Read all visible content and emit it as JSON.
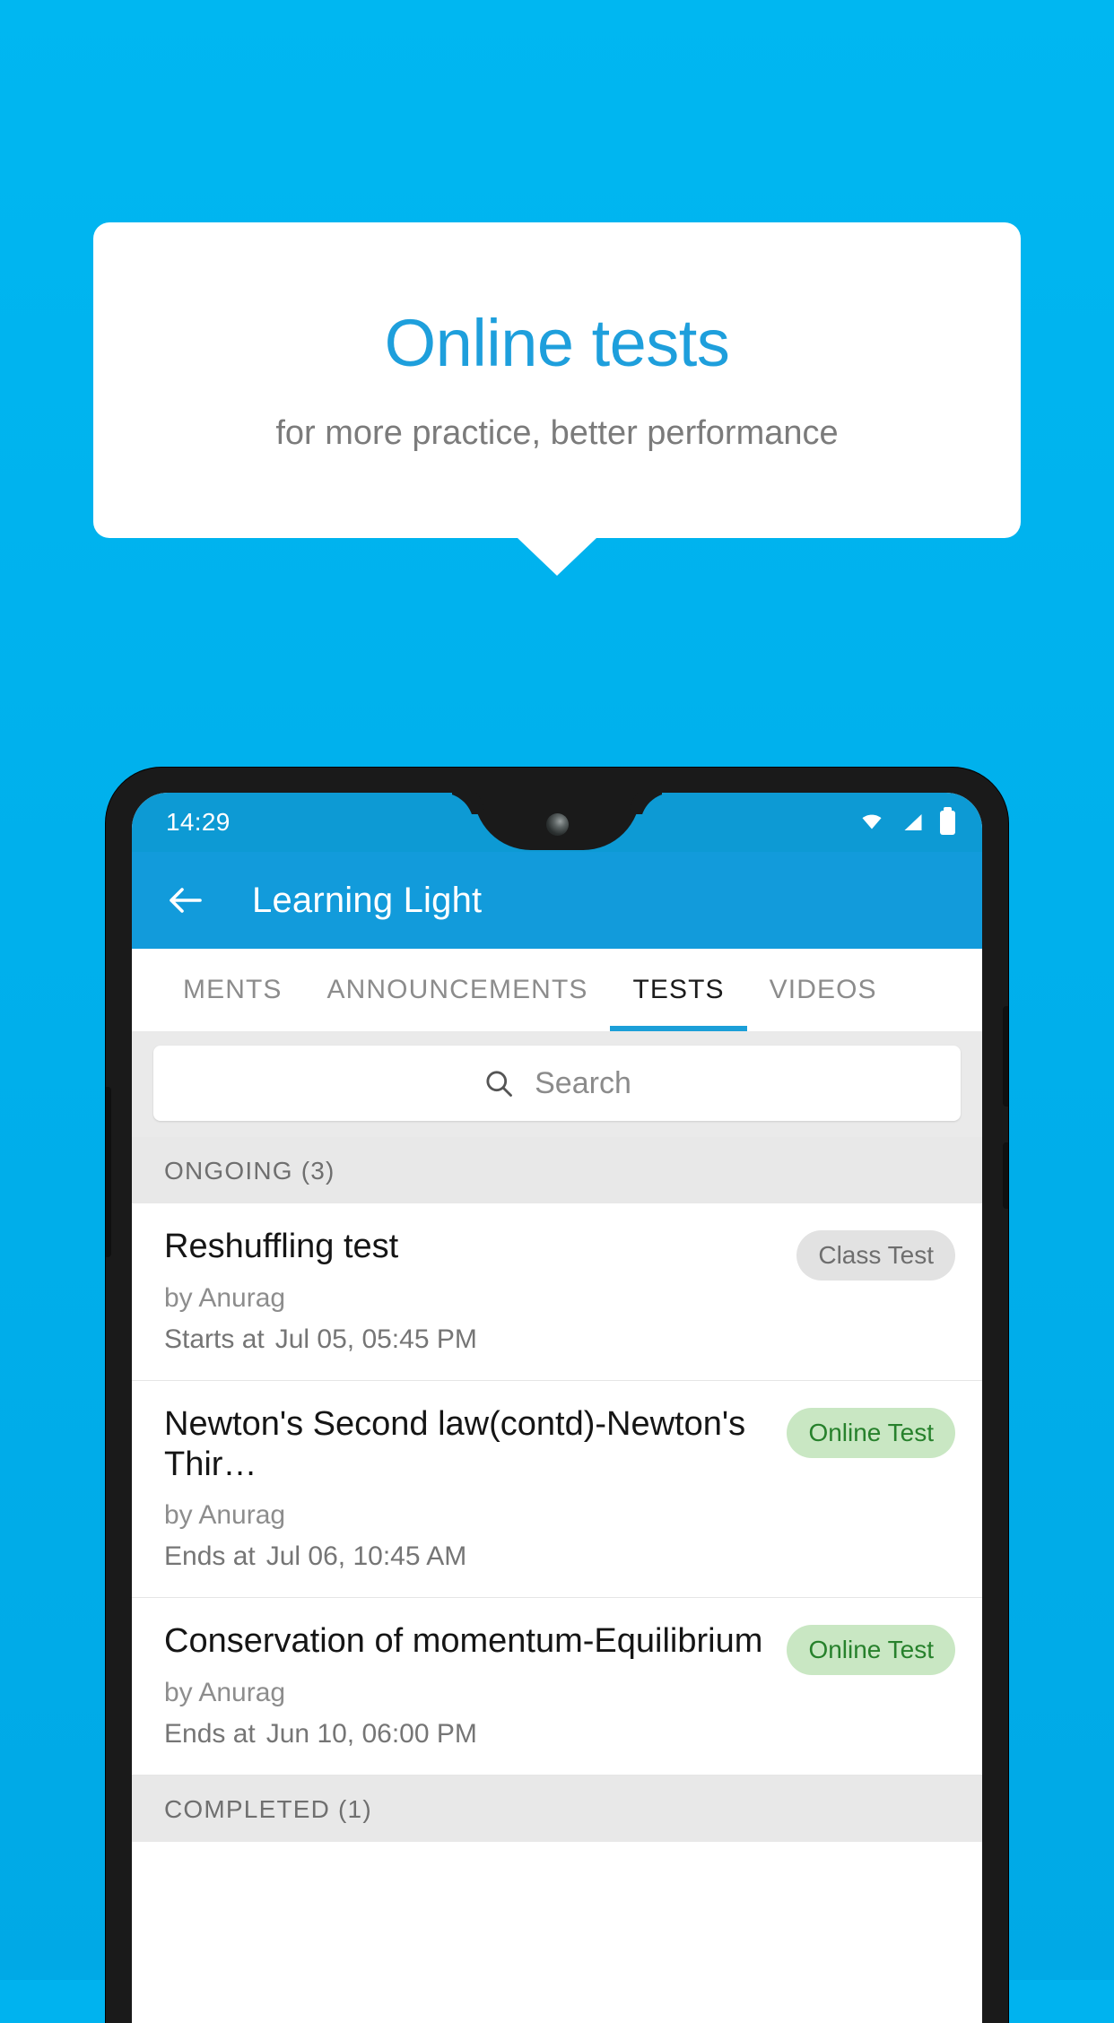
{
  "promo": {
    "title": "Online tests",
    "subtitle": "for more practice, better performance",
    "background_color": "#00b3ef",
    "title_color": "#1e9fdc"
  },
  "phone": {
    "status_bar": {
      "time": "14:29",
      "icons": [
        "wifi-icon",
        "signal-icon",
        "battery-icon"
      ],
      "background_color": "#0d9ad4"
    },
    "app_bar": {
      "back_icon": "back-arrow-icon",
      "title": "Learning Light",
      "background_color": "#129bdb"
    },
    "tabs": [
      {
        "label": "MENTS",
        "active": false
      },
      {
        "label": "ANNOUNCEMENTS",
        "active": false
      },
      {
        "label": "TESTS",
        "active": true
      },
      {
        "label": "VIDEOS",
        "active": false
      }
    ],
    "search": {
      "icon": "search-icon",
      "placeholder": "Search",
      "value": ""
    },
    "sections": [
      {
        "header": "ONGOING (3)",
        "items": [
          {
            "title": "Reshuffling test",
            "author": "by Anurag",
            "time_label": "Starts at",
            "time_value": "Jul 05, 05:45 PM",
            "badge": "Class Test",
            "badge_type": "grey"
          },
          {
            "title": "Newton's Second law(contd)-Newton's Thir…",
            "author": "by Anurag",
            "time_label": "Ends at",
            "time_value": "Jul 06, 10:45 AM",
            "badge": "Online Test",
            "badge_type": "green"
          },
          {
            "title": "Conservation of momentum-Equilibrium",
            "author": "by Anurag",
            "time_label": "Ends at",
            "time_value": "Jun 10, 06:00 PM",
            "badge": "Online Test",
            "badge_type": "green"
          }
        ]
      },
      {
        "header": "COMPLETED (1)",
        "items": []
      }
    ]
  }
}
